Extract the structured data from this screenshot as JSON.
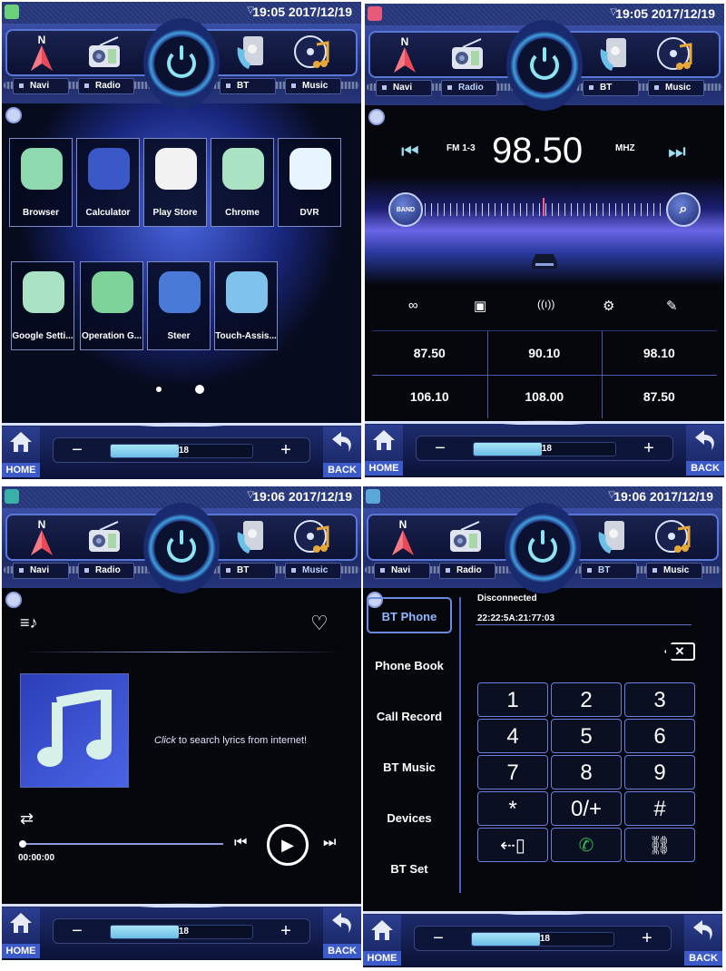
{
  "screens": {
    "apps": {
      "status": {
        "time": "19:05 2017/12/19"
      },
      "dock": {
        "navi": "Navi",
        "radio": "Radio",
        "bt": "BT",
        "music": "Music"
      },
      "apps": [
        {
          "label": "Browser",
          "icon": "globe-icon",
          "color": "#8fd9b0"
        },
        {
          "label": "Calculator",
          "icon": "calculator-icon",
          "color": "#3a58c8"
        },
        {
          "label": "Play Store",
          "icon": "play-store-icon",
          "color": "#f2f2f2"
        },
        {
          "label": "Chrome",
          "icon": "chrome-icon",
          "color": "#a9e3c4"
        },
        {
          "label": "DVR",
          "icon": "camera-icon",
          "color": "#e8f4ff"
        },
        {
          "label": "Google Setti...",
          "icon": "google-settings-icon",
          "color": "#a9e3c4"
        },
        {
          "label": "Operation G...",
          "icon": "reading-guide-icon",
          "color": "#7ed39a"
        },
        {
          "label": "Steer",
          "icon": "steering-wheel-icon",
          "color": "#4a7ad8"
        },
        {
          "label": "Touch-Assis...",
          "icon": "touch-assist-icon",
          "color": "#7fc2ee"
        }
      ],
      "pager": {
        "pages": 2,
        "current": 2
      },
      "bottom": {
        "home": "HOME",
        "back": "BACK",
        "minus": "−",
        "plus": "+",
        "volume": "18",
        "volume_fraction": 0.48
      }
    },
    "radio": {
      "status": {
        "time": "19:05 2017/12/19"
      },
      "dock": {
        "navi": "Navi",
        "radio": "Radio",
        "bt": "BT",
        "music": "Music"
      },
      "band": "FM 1-3",
      "frequency": "98.50",
      "unit": "MHZ",
      "band_button": "BAND",
      "tools": [
        "stereo-icon",
        "save-icon",
        "antenna-icon",
        "settings-icon",
        "edit-icon"
      ],
      "presets": [
        "87.50",
        "90.10",
        "98.10",
        "106.10",
        "108.00",
        "87.50"
      ],
      "bottom": {
        "home": "HOME",
        "back": "BACK",
        "minus": "−",
        "plus": "+",
        "volume": "18",
        "volume_fraction": 0.48
      }
    },
    "music": {
      "status": {
        "time": "19:06 2017/12/19"
      },
      "dock": {
        "navi": "Navi",
        "radio": "Radio",
        "bt": "BT",
        "music": "Music"
      },
      "lyrics_click": "Click",
      "lyrics_rest": " to search lyrics from internet!",
      "time": "00:00:00",
      "progress_fraction": 0.0,
      "bottom": {
        "home": "HOME",
        "back": "BACK",
        "minus": "−",
        "plus": "+",
        "volume": "18",
        "volume_fraction": 0.48
      }
    },
    "bt": {
      "status": {
        "time": "19:06 2017/12/19"
      },
      "dock": {
        "navi": "Navi",
        "radio": "Radio",
        "bt": "BT",
        "music": "Music"
      },
      "menu": [
        "BT Phone",
        "Phone Book",
        "Call Record",
        "BT Music",
        "Devices",
        "BT Set"
      ],
      "connection": "Disconnected",
      "mac": "22:22:5A:21:77:03",
      "keys": [
        "1",
        "2",
        "3",
        "4",
        "5",
        "6",
        "7",
        "8",
        "9",
        "*",
        "0/+",
        "#"
      ],
      "call_color": "#2fb84a",
      "bottom": {
        "home": "HOME",
        "back": "BACK",
        "minus": "−",
        "plus": "+",
        "volume": "18",
        "volume_fraction": 0.48
      }
    }
  }
}
